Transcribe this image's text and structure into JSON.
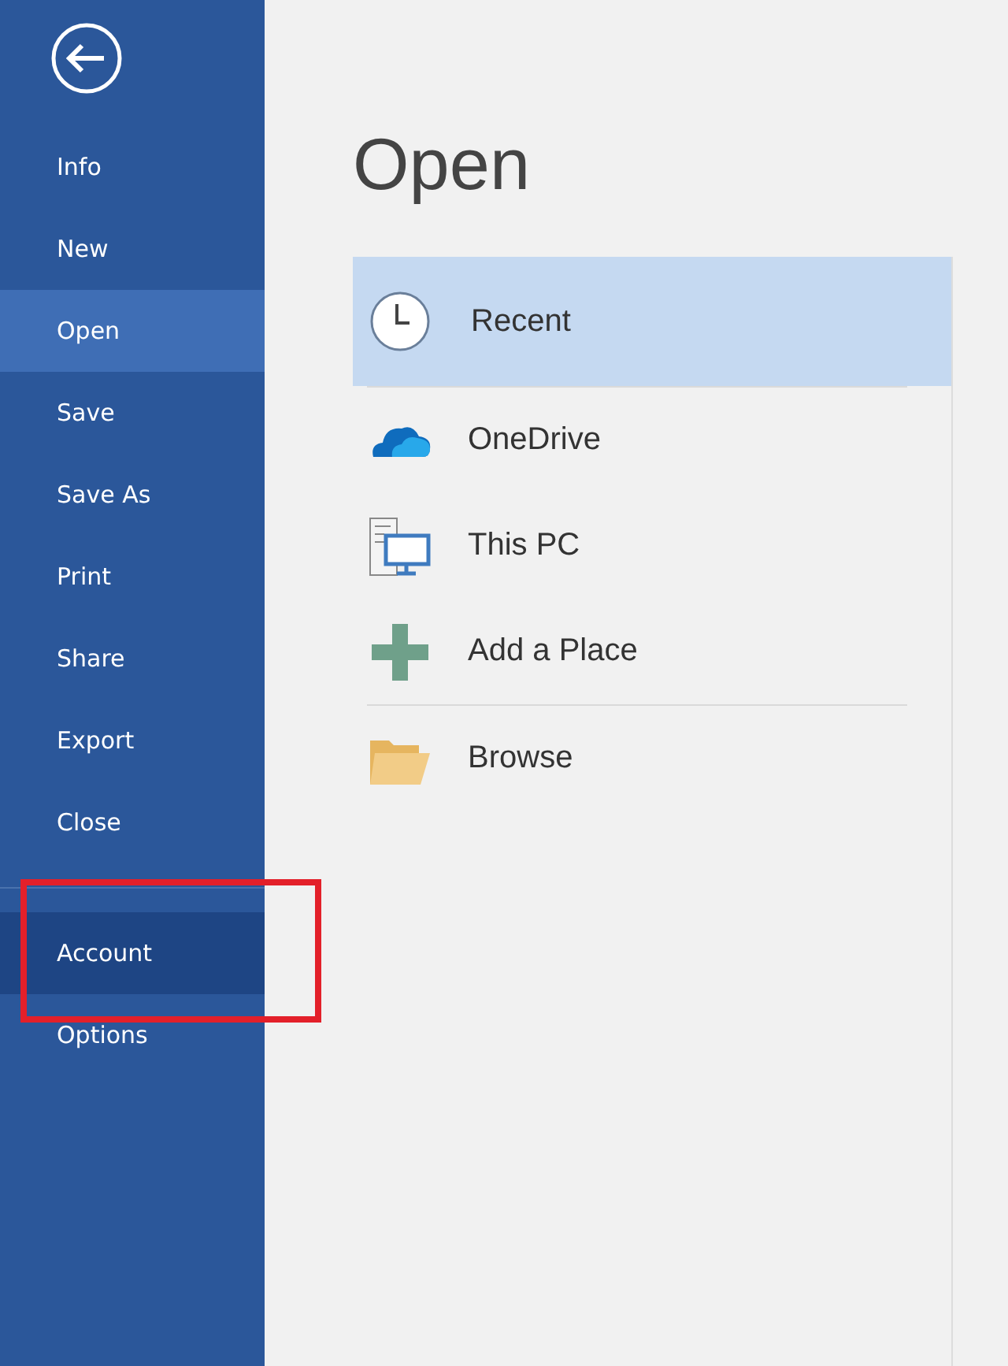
{
  "sidebar": {
    "groups": [
      {
        "items": [
          {
            "label": "Info",
            "selected": false,
            "hovered": false
          },
          {
            "label": "New",
            "selected": false,
            "hovered": false
          },
          {
            "label": "Open",
            "selected": true,
            "hovered": false
          },
          {
            "label": "Save",
            "selected": false,
            "hovered": false
          },
          {
            "label": "Save As",
            "selected": false,
            "hovered": false
          },
          {
            "label": "Print",
            "selected": false,
            "hovered": false
          },
          {
            "label": "Share",
            "selected": false,
            "hovered": false
          },
          {
            "label": "Export",
            "selected": false,
            "hovered": false
          },
          {
            "label": "Close",
            "selected": false,
            "hovered": false
          }
        ]
      },
      {
        "items": [
          {
            "label": "Account",
            "selected": false,
            "hovered": true
          },
          {
            "label": "Options",
            "selected": false,
            "hovered": false
          }
        ]
      }
    ]
  },
  "page": {
    "title": "Open",
    "place_groups": [
      {
        "items": [
          {
            "kind": "clock",
            "label": "Recent",
            "selected": true
          }
        ]
      },
      {
        "items": [
          {
            "kind": "cloud",
            "label": "OneDrive",
            "selected": false
          },
          {
            "kind": "computer",
            "label": "This PC",
            "selected": false
          },
          {
            "kind": "plus",
            "label": "Add a Place",
            "selected": false
          }
        ]
      },
      {
        "items": [
          {
            "kind": "folder",
            "label": "Browse",
            "selected": false
          }
        ]
      }
    ]
  }
}
